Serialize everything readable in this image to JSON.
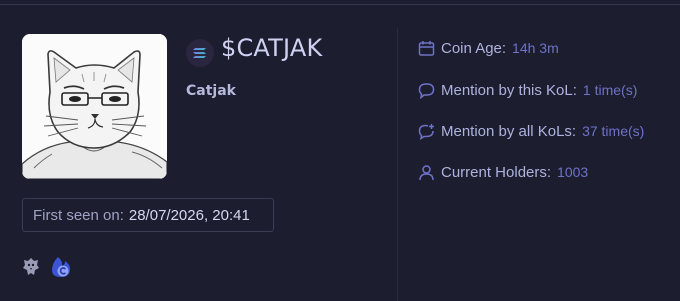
{
  "token": {
    "ticker": "$CATJAK",
    "name": "Catjak",
    "chain_icon": "solana-icon",
    "image_icon": "catjak-meme-avatar"
  },
  "first_seen": {
    "label": "First seen on:",
    "value": "28/07/2026, 20:41"
  },
  "stats": [
    {
      "icon": "calendar-icon",
      "label": "Coin Age:",
      "value": "14h 3m"
    },
    {
      "icon": "speech-bubble-icon",
      "label": "Mention by this KoL:",
      "value": "1 time(s)"
    },
    {
      "icon": "speech-bubble-plus-icon",
      "label": "Mention by all KoLs:",
      "value": "37 time(s)"
    },
    {
      "icon": "user-icon",
      "label": "Current Holders:",
      "value": "1003"
    }
  ],
  "social": [
    "eagle-icon",
    "flame-c-icon"
  ],
  "colors": {
    "background": "#1c1d2e",
    "accent": "#6e73c8",
    "label": "#aeb2de",
    "title": "#cfd1f2"
  }
}
